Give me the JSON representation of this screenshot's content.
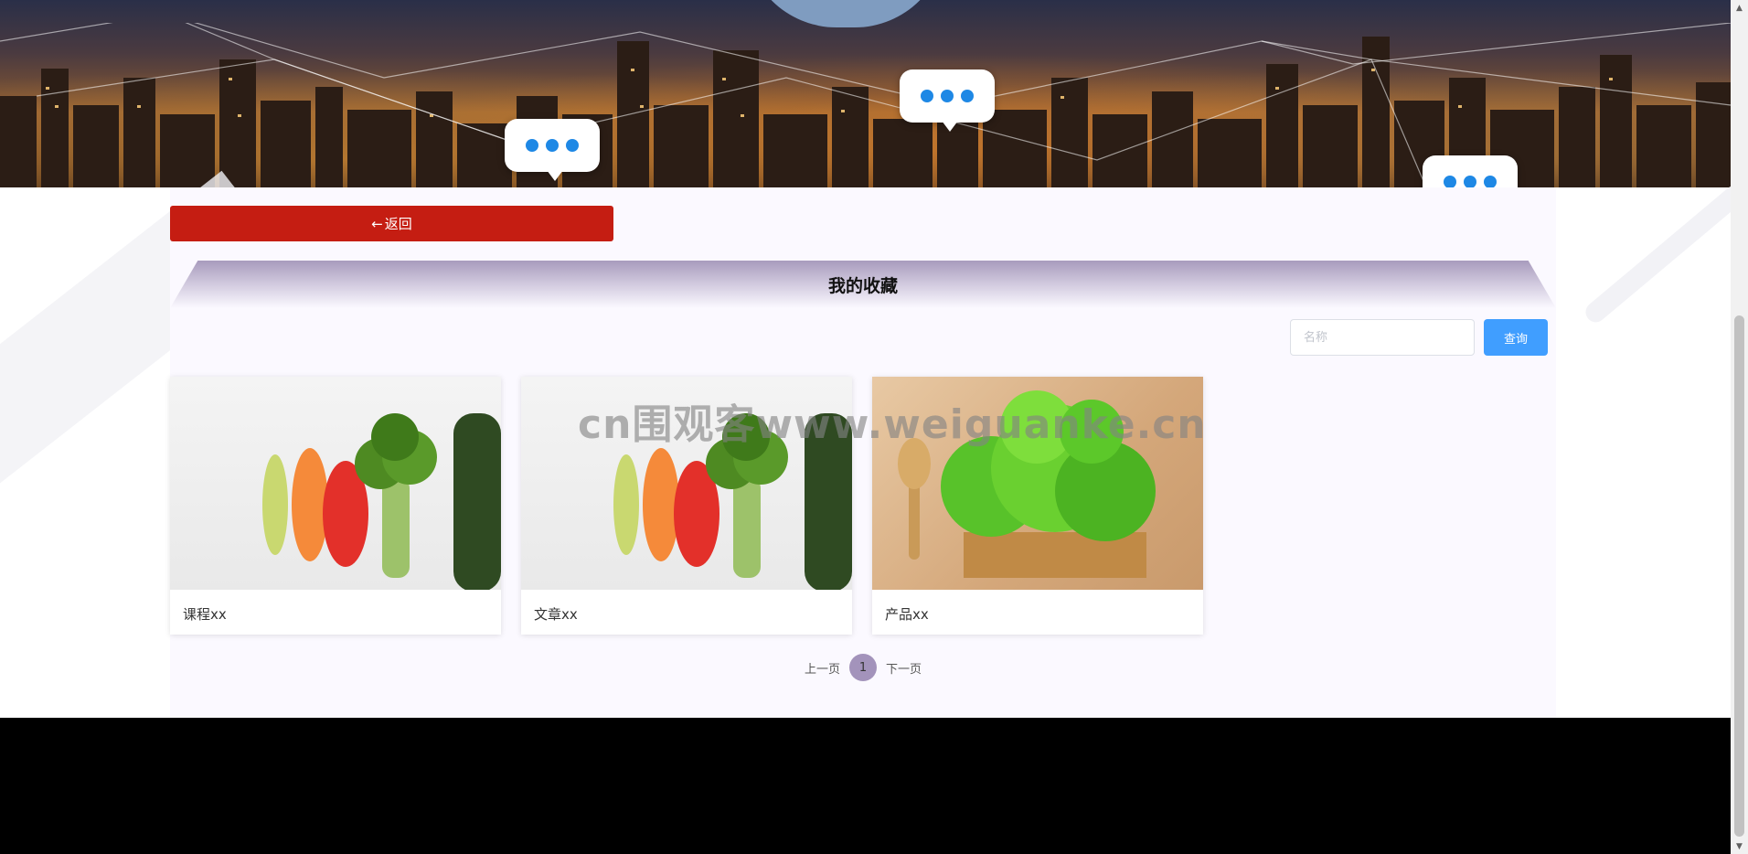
{
  "banner": {
    "alt": "city night skyline banner"
  },
  "back_button": {
    "arrow": "←",
    "label": "返回"
  },
  "section": {
    "title": "我的收藏"
  },
  "search": {
    "placeholder": "名称",
    "value": "",
    "button_label": "查询"
  },
  "cards": [
    {
      "label": "课程xx",
      "image": "vegetables"
    },
    {
      "label": "文章xx",
      "image": "vegetables"
    },
    {
      "label": "产品xx",
      "image": "lettuce"
    }
  ],
  "pagination": {
    "prev_label": "上一页",
    "current_page": "1",
    "next_label": "下一页"
  },
  "watermark": "cn围观客www.weiguanke.cn",
  "colors": {
    "back_button": "#c51d12",
    "search_button": "#409eff",
    "page_active": "#a393bb",
    "title_band": "#a89bbd",
    "footer": "#000000"
  }
}
